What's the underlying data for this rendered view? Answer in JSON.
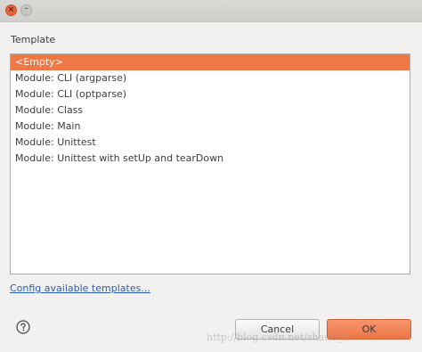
{
  "dialog": {
    "template_label": "Template",
    "templates": [
      "<Empty>",
      "Module: CLI (argparse)",
      "Module: CLI (optparse)",
      "Module: Class",
      "Module: Main",
      "Module: Unittest",
      "Module: Unittest with setUp and tearDown"
    ],
    "selected_index": 0,
    "config_link": "Config available templates...",
    "cancel_label": "Cancel",
    "ok_label": "OK",
    "watermark": "http://blog.csdn.net/shaun_fl"
  },
  "colors": {
    "accent": "#f07746",
    "link": "#2a5db0",
    "background": "#f2f1f0"
  },
  "icons": {
    "close": "close-icon",
    "minimize": "minimize-icon",
    "help": "help-icon"
  }
}
